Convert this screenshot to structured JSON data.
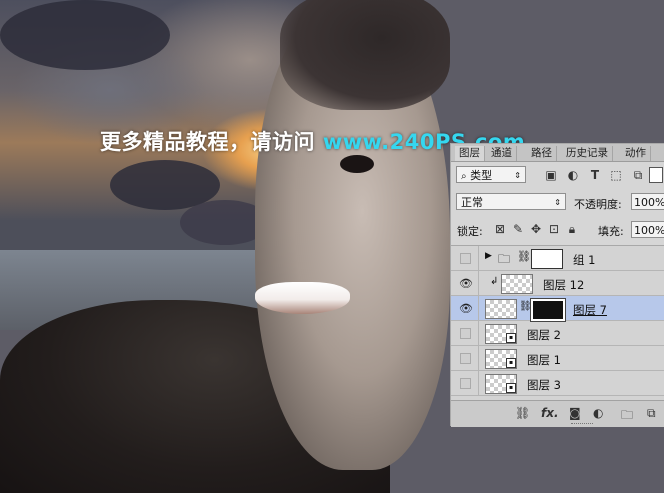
{
  "watermark": {
    "prefix": "更多精品教程，请访问 ",
    "url": "www.240PS.com"
  },
  "layers_panel": {
    "tabs": [
      "图层",
      "通道",
      "路径",
      "历史记录",
      "动作"
    ],
    "active_tab": "图层",
    "filter_kind": "类型",
    "blend_mode": "正常",
    "opacity_label": "不透明度:",
    "opacity_value": "100%",
    "lock_label": "锁定:",
    "fill_label": "填充:",
    "fill_value": "100%",
    "layers": [
      {
        "name": "组 1",
        "type": "group",
        "visible": false,
        "selected": false
      },
      {
        "name": "图层 12",
        "type": "clipped",
        "visible": true,
        "selected": false
      },
      {
        "name": "图层 7",
        "type": "masked",
        "visible": true,
        "selected": true
      },
      {
        "name": "图层 2",
        "type": "smart",
        "visible": false,
        "selected": false
      },
      {
        "name": "图层 1",
        "type": "smart",
        "visible": false,
        "selected": false
      },
      {
        "name": "图层 3",
        "type": "smart",
        "visible": false,
        "selected": false
      }
    ],
    "selected_color": "#b7c8ea"
  },
  "colors": {
    "canvas_background": "#5b5b63",
    "watermark_url": "#35d7ef"
  }
}
